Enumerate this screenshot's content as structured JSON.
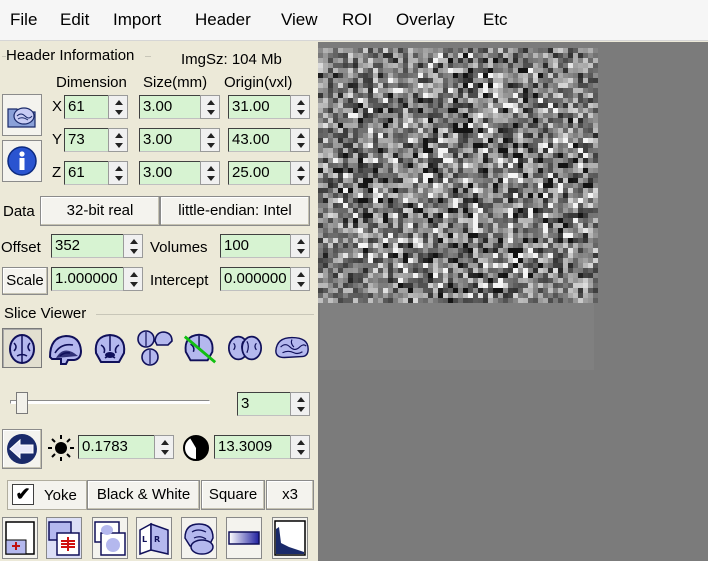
{
  "menu": [
    "File",
    "Edit",
    "Import",
    "Header",
    "View",
    "ROI",
    "Overlay",
    "Etc"
  ],
  "header_info": {
    "title": "Header Information",
    "imgsz": "ImgSz: 104 Mb",
    "col_dimension": "Dimension",
    "col_size": "Size(mm)",
    "col_origin": "Origin(vxl)",
    "rows": [
      {
        "axis": "X",
        "dim": "61",
        "size": "3.00",
        "origin": "31.00"
      },
      {
        "axis": "Y",
        "dim": "73",
        "size": "3.00",
        "origin": "43.00"
      },
      {
        "axis": "Z",
        "dim": "61",
        "size": "3.00",
        "origin": "25.00"
      }
    ],
    "data_label": "Data",
    "datatype": "32-bit real",
    "endian": "little-endian: Intel",
    "offset_label": "Offset",
    "offset": "352",
    "volumes_label": "Volumes",
    "volumes": "100",
    "scale_label": "Scale",
    "scale": "1.000000",
    "intercept_label": "Intercept",
    "intercept": "0.000000"
  },
  "slice_viewer": {
    "title": "Slice Viewer",
    "view_icons": [
      "axial-view-icon",
      "sagittal-view-icon",
      "coronal-view-icon",
      "multiplanar-view-icon",
      "oblique-view-icon",
      "mosaic-view-icon",
      "render-view-icon"
    ],
    "slider_value": 3,
    "slider_max": 100,
    "volume_spin": "3",
    "brightness": "0.1783",
    "contrast": "13.3009",
    "yoke_label": "Yoke",
    "yoke_checked": true,
    "colormap": "Black & White",
    "shape": "Square",
    "zoom": "x3"
  },
  "colors": {
    "panel": "#ece9d8",
    "field": "#d7f3d2",
    "viewport": "#7b7b7b",
    "icon_fill": "#b4b8ee"
  }
}
